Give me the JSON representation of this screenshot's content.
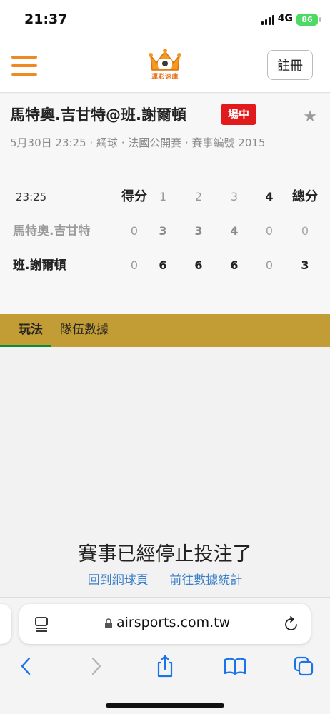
{
  "status_bar": {
    "time": "21:37",
    "network": "4G",
    "battery": "86"
  },
  "header": {
    "logo_text": "運彩速庫",
    "register_label": "註冊"
  },
  "match": {
    "title": "馬特奧.吉甘特@班.謝爾頓",
    "status_badge": "場中",
    "meta": "5月30日 23:25 · 網球 · 法國公開賽 · 賽事編號 2015"
  },
  "scoreboard": {
    "header": {
      "time": "23:25",
      "score_label": "得分",
      "sets": [
        "1",
        "2",
        "3",
        "4"
      ],
      "total_label": "總分"
    },
    "rows": [
      {
        "name": "馬特奧.吉甘特",
        "score": "0",
        "sets": [
          "3",
          "3",
          "4",
          "0"
        ],
        "total": "0"
      },
      {
        "name": "班.謝爾頓",
        "score": "0",
        "sets": [
          "6",
          "6",
          "6",
          "0"
        ],
        "total": "3"
      }
    ]
  },
  "tabs": [
    {
      "label": "玩法",
      "active": true
    },
    {
      "label": "隊伍數據",
      "active": false
    }
  ],
  "content": {
    "message": "賽事已經停止投注了",
    "link_back": "回到網球頁",
    "link_stats": "前往數據統計"
  },
  "browser": {
    "url": "airsports.com.tw"
  },
  "colors": {
    "accent": "#ef8a22",
    "tab_bar": "#c29c34",
    "live": "#e11b1b",
    "link": "#3a7ec8",
    "tab_indicator": "#0a8a3a"
  },
  "icons": [
    "hamburger-icon",
    "crown-logo-icon",
    "star-icon",
    "page-icon",
    "lock-icon",
    "reload-icon",
    "back-icon",
    "forward-icon",
    "share-icon",
    "bookmarks-icon",
    "tabs-icon"
  ]
}
